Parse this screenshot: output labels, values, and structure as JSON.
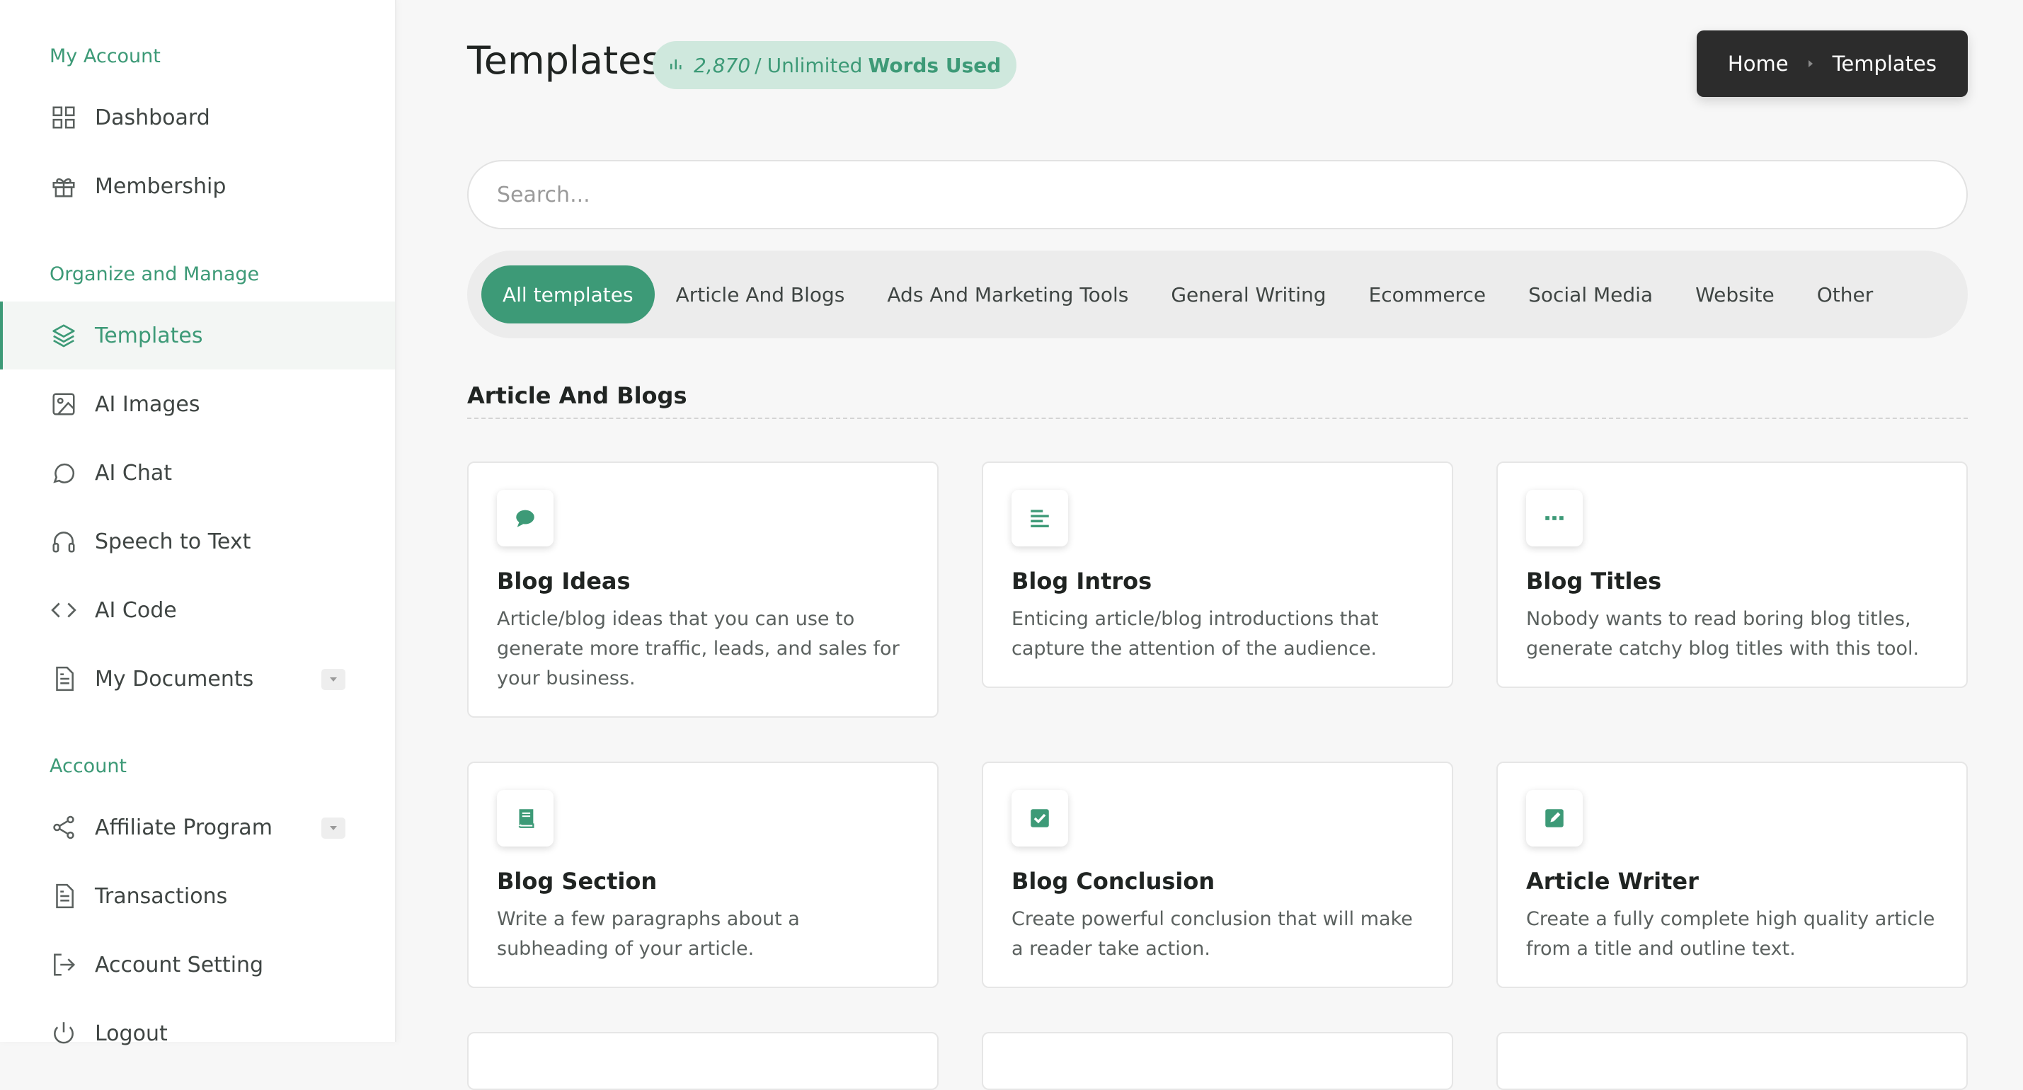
{
  "sidebar": {
    "sections": [
      {
        "label": "My Account"
      },
      {
        "label": "Organize and Manage"
      },
      {
        "label": "Account"
      }
    ],
    "items": [
      {
        "label": "Dashboard",
        "icon": "grid-icon"
      },
      {
        "label": "Membership",
        "icon": "gift-icon"
      },
      {
        "label": "Templates",
        "icon": "layers-icon",
        "active": true
      },
      {
        "label": "AI Images",
        "icon": "image-icon"
      },
      {
        "label": "AI Chat",
        "icon": "chat-bubble-icon"
      },
      {
        "label": "Speech to Text",
        "icon": "headphones-icon"
      },
      {
        "label": "AI Code",
        "icon": "code-icon"
      },
      {
        "label": "My Documents",
        "icon": "document-icon",
        "has_dropdown": true
      },
      {
        "label": "Affiliate Program",
        "icon": "share-icon",
        "has_dropdown": true
      },
      {
        "label": "Transactions",
        "icon": "document-icon"
      },
      {
        "label": "Account Setting",
        "icon": "logout-arrow-icon"
      },
      {
        "label": "Logout",
        "icon": "power-icon"
      }
    ]
  },
  "header": {
    "title": "Templates",
    "words_used": {
      "icon": "bar-chart-icon",
      "count": "2,870",
      "separator": "/",
      "limit": "Unlimited",
      "label": "Words Used"
    },
    "breadcrumb": {
      "items": [
        "Home",
        "Templates"
      ]
    }
  },
  "search": {
    "placeholder": "Search...",
    "value": ""
  },
  "filters": {
    "tabs": [
      {
        "label": "All templates",
        "active": true
      },
      {
        "label": "Article And Blogs"
      },
      {
        "label": "Ads And Marketing Tools"
      },
      {
        "label": "General Writing"
      },
      {
        "label": "Ecommerce"
      },
      {
        "label": "Social Media"
      },
      {
        "label": "Website"
      },
      {
        "label": "Other"
      }
    ]
  },
  "section": {
    "title": "Article And Blogs",
    "cards": [
      {
        "title": "Blog Ideas",
        "description": "Article/blog ideas that you can use to generate more traffic, leads, and sales for your business.",
        "icon": "comment-icon"
      },
      {
        "title": "Blog Intros",
        "description": "Enticing article/blog introductions that capture the attention of the audience.",
        "icon": "align-left-icon"
      },
      {
        "title": "Blog Titles",
        "description": "Nobody wants to read boring blog titles, generate catchy blog titles with this tool.",
        "icon": "ellipsis-icon"
      },
      {
        "title": "Blog Section",
        "description": "Write a few paragraphs about a subheading of your article.",
        "icon": "book-icon"
      },
      {
        "title": "Blog Conclusion",
        "description": "Create powerful conclusion that will make a reader take action.",
        "icon": "check-square-icon"
      },
      {
        "title": "Article Writer",
        "description": "Create a fully complete high quality article from a title and outline text.",
        "icon": "edit-square-icon"
      }
    ]
  },
  "colors": {
    "accent": "#3d9a77",
    "accent_light": "#cfe8dd",
    "breadcrumb_bg": "#2c2c2c",
    "page_bg": "#f7f7f7"
  }
}
